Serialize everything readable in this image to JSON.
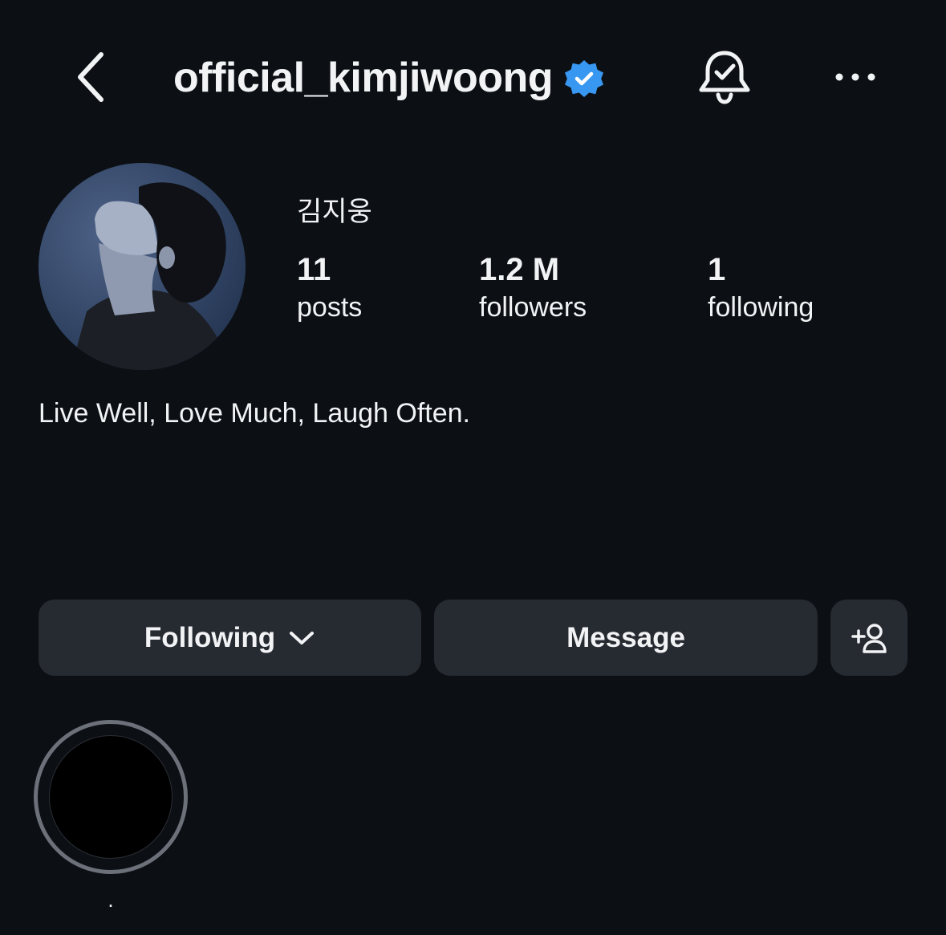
{
  "header": {
    "username": "official_kimjiwoong",
    "verified": true,
    "verified_color": "#3897f0",
    "icons": [
      "back-icon",
      "verified-icon",
      "bell-check-icon",
      "more-icon"
    ]
  },
  "profile": {
    "display_name": "김지웅",
    "bio": "Live Well, Love Much, Laugh Often."
  },
  "stats": {
    "posts": {
      "value": "11",
      "label": "posts"
    },
    "followers": {
      "value": "1.2 M",
      "label": "followers"
    },
    "following": {
      "value": "1",
      "label": "following"
    }
  },
  "actions": {
    "following_label": "Following",
    "message_label": "Message",
    "add_icon": "add-person-icon"
  },
  "highlights": [
    {
      "label": "."
    }
  ],
  "colors": {
    "background": "#0c1015",
    "button": "#262a31",
    "text": "#f2f3f5"
  }
}
